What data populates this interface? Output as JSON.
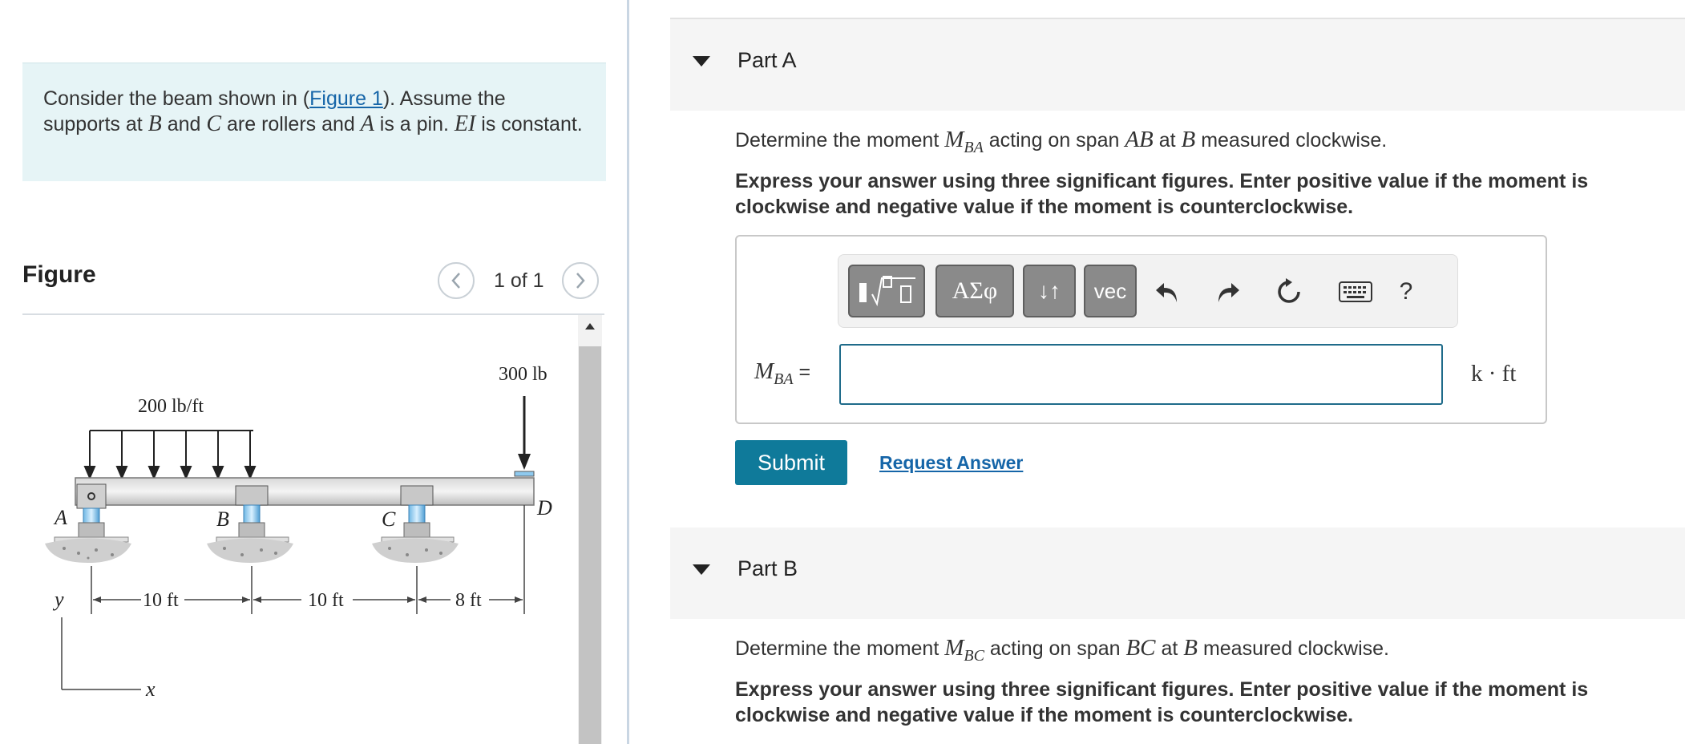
{
  "problem": {
    "text_pre": "Consider the beam shown in (",
    "figure_link": "Figure 1",
    "text_mid1": "). Assume the supports at ",
    "var_b": "B",
    "text_and": " and ",
    "var_c": "C",
    "text_rollers": " are rollers and ",
    "var_a": "A",
    "text_pin": " is a pin. ",
    "var_ei": "EI",
    "text_end": " is constant."
  },
  "figure": {
    "title": "Figure",
    "counter": "1 of 1",
    "prev_icon": "chevron-left-icon",
    "next_icon": "chevron-right-icon",
    "labels": {
      "dist_load": "200 lb/ft",
      "point_load": "300 lb",
      "A": "A",
      "B": "B",
      "C": "C",
      "D": "D",
      "span1": "10 ft",
      "span2": "10 ft",
      "span3": "8 ft",
      "axis_y": "y",
      "axis_x": "x"
    }
  },
  "parts": [
    {
      "title": "Part A",
      "q_pre": "Determine the moment ",
      "m_main": "M",
      "m_sub": "BA",
      "q_mid": " acting on span ",
      "span": "AB",
      "q_at": " at ",
      "pt": "B",
      "q_end": " measured clockwise.",
      "instruction": "Express your answer using three significant figures. Enter positive value if the moment is clockwise and negative value if the moment is counterclockwise."
    },
    {
      "title": "Part B",
      "q_pre": "Determine the moment ",
      "m_main": "M",
      "m_sub": "BC",
      "q_mid": " acting on span ",
      "span": "BC",
      "q_at": " at ",
      "pt": "B",
      "q_end": " measured clockwise.",
      "instruction": "Express your answer using three significant figures. Enter positive value if the moment is clockwise and negative value if the moment is counterclockwise."
    }
  ],
  "toolbar": {
    "templates_icon": "fraction-radical-templates-icon",
    "greek_label": "ΑΣφ",
    "arrows_label": "↓↑",
    "vec_label": "vec",
    "undo_icon": "undo-icon",
    "redo_icon": "redo-icon",
    "reset_icon": "reset-icon",
    "keyboard_icon": "keyboard-icon",
    "help_label": "?"
  },
  "answer": {
    "label_main": "M",
    "label_sub": "BA",
    "equals": " =",
    "value": "",
    "unit": "k · ft"
  },
  "actions": {
    "submit": "Submit",
    "request": "Request Answer"
  }
}
